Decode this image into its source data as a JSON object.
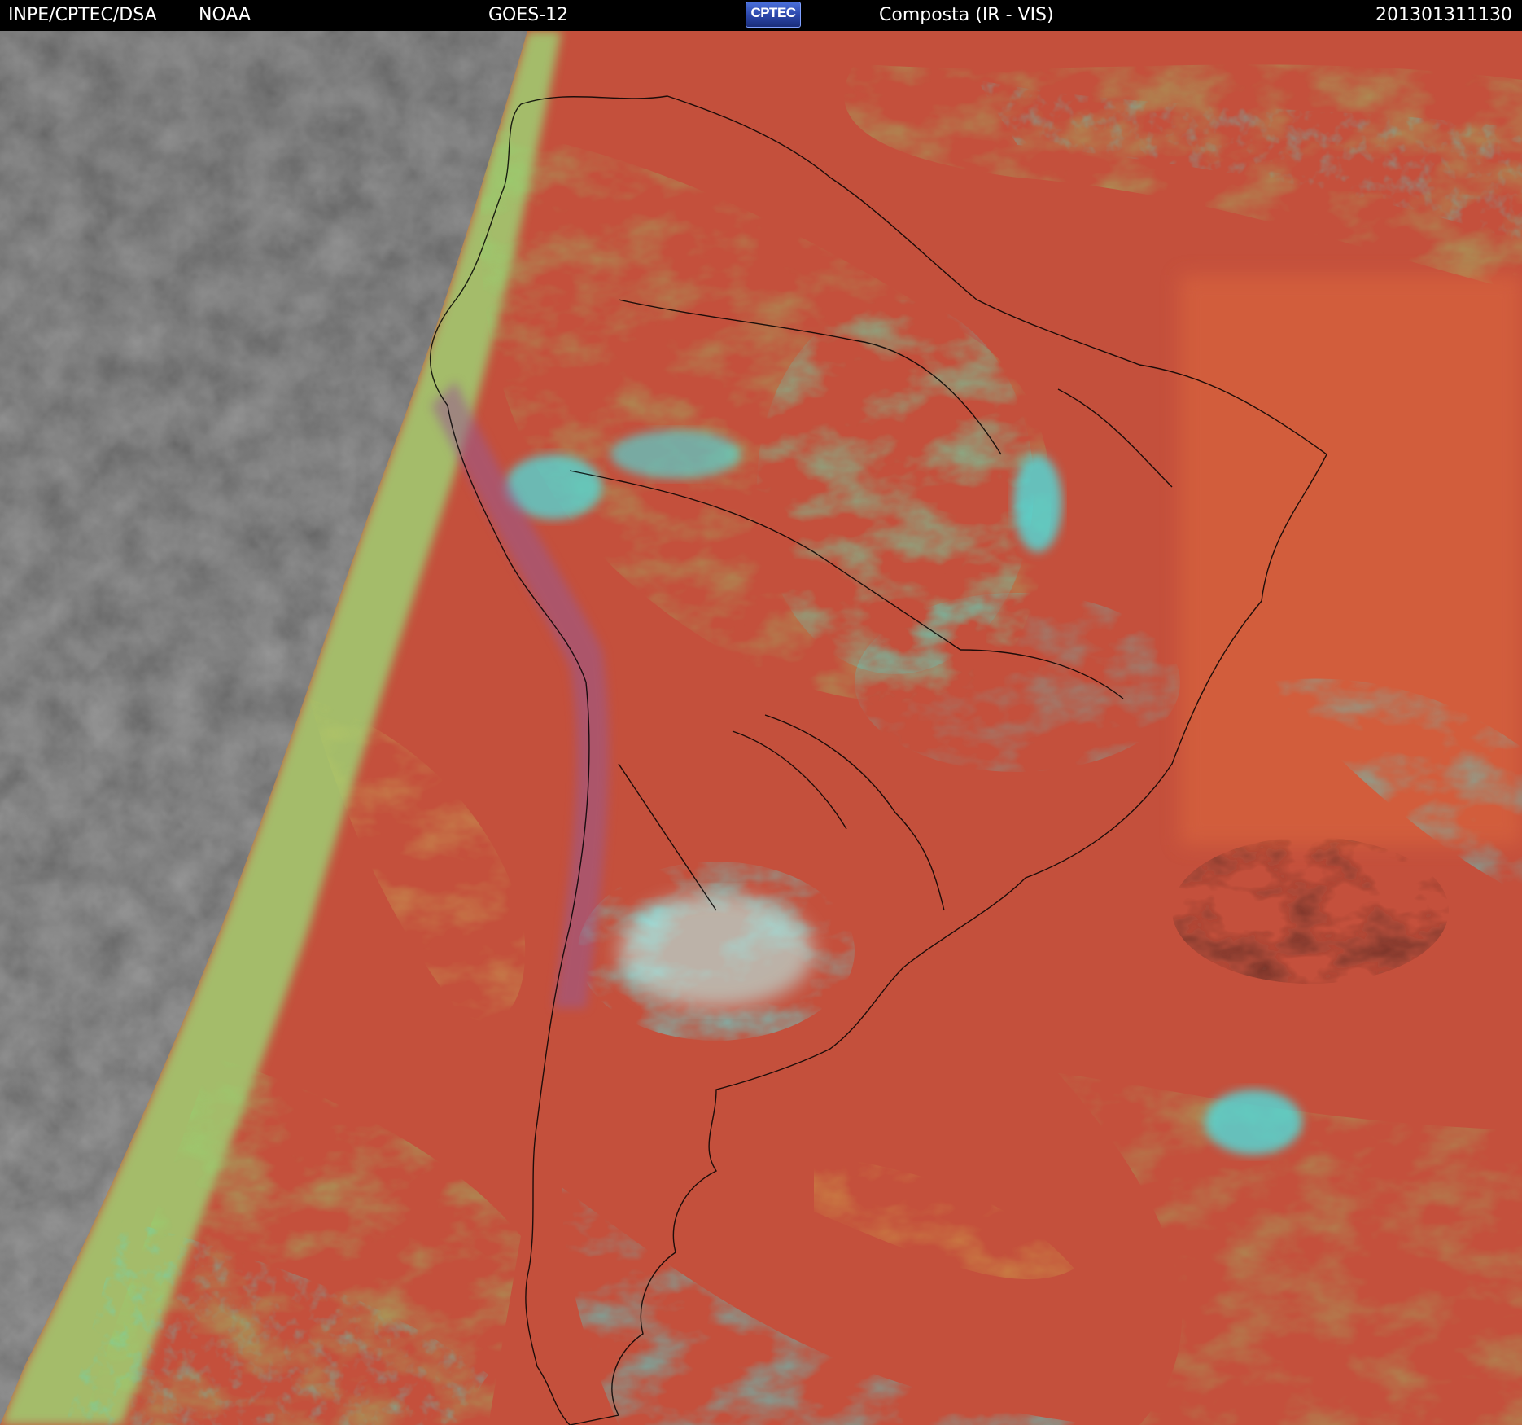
{
  "header": {
    "agency": "INPE/CPTEC/DSA",
    "partner": "NOAA",
    "satellite": "GOES-12",
    "logo_text": "CPTEC",
    "product": "Composta (IR - VIS)",
    "timestamp": "201301311130"
  },
  "colors": {
    "night_side": "#3c3c3c",
    "clear_sky": "#c4503c",
    "high_cloud": "#46e6e6",
    "mid_cloud": "#8ae678",
    "low_cloud": "#dcc864",
    "border_lines": "#000000"
  },
  "icons": {
    "logo": "cptec-logo"
  }
}
